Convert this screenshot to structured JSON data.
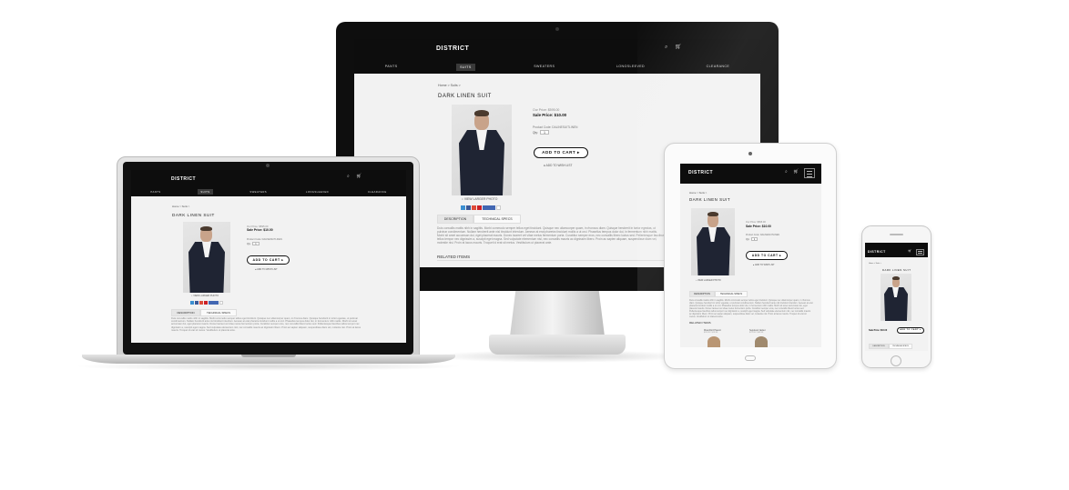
{
  "site": {
    "logo": "DISTRICT",
    "nav": [
      "PANTS",
      "SUITS",
      "SWEATERS",
      "LONGSLEEVED",
      "CLEARANCE"
    ],
    "active_nav": "SUITS",
    "breadcrumb": "Home > Suits >",
    "product_title": "DARK LINEN SUIT",
    "our_price": "Our Price: $595.00",
    "sale_price": "Sale Price: $10.00",
    "product_code": "Product Code: DALINESUITLINEN",
    "qty_label": "Qty:",
    "qty_value": "1",
    "add_to_cart": "ADD TO CART",
    "add_to_wishlist": "ADD TO WISH LIST",
    "view_larger": "VIEW LARGER PHOTO",
    "tabs": [
      "DESCRIPTION",
      "TECHNICAL SPECS"
    ],
    "related_items": "RELATED ITEMS",
    "related": [
      {
        "name": "Mountford Pascot",
        "price": "$29.99 / $19.99"
      },
      {
        "name": "Sepulved Jacket",
        "price": "$79.99 / $49.99"
      }
    ],
    "description": "Duis convallis mattis nibh in sagittis. Morbi commodo semper tellus eget tincidunt. Quisque nec ullamcorper quam, in rhoncus diam. Quisque hendrerit in tortor egestas, ut pulvinar condimentum. Nullam hendrerit ante nisl tincidunt interdum. Aenean at erat pharetra tincidunt mollis a ut orci. Phasellus tempus dolor dui, in fermentum nibh mattis. Morbi sit amet accumsan dui, eget placerat mauris. Donec laoreet vel vitae metus fermentum porta. Curabitur semper eros, nec convallis libero luctus sed. Pellentesque faucibus tellus tempor nec dignissim a, suscipit eget magna. Sed vulputate elementum nisl, nec convallis mauris ac dignissim libero. Proin ac sapien aliquam, suspendisse diam vel, molestie nisi. Proin at lacus mauris. Troquet id erat sit metus. Vestibulum ut placerat ante."
  },
  "colors": {
    "header_bg": "#0d0d0d",
    "page_bg": "#f2f2f2",
    "active_tab": "#3a3a3a"
  },
  "icons": [
    "search-icon",
    "cart-icon",
    "menu-icon",
    "magnifier-icon",
    "heart-icon",
    "arrow-icon"
  ]
}
